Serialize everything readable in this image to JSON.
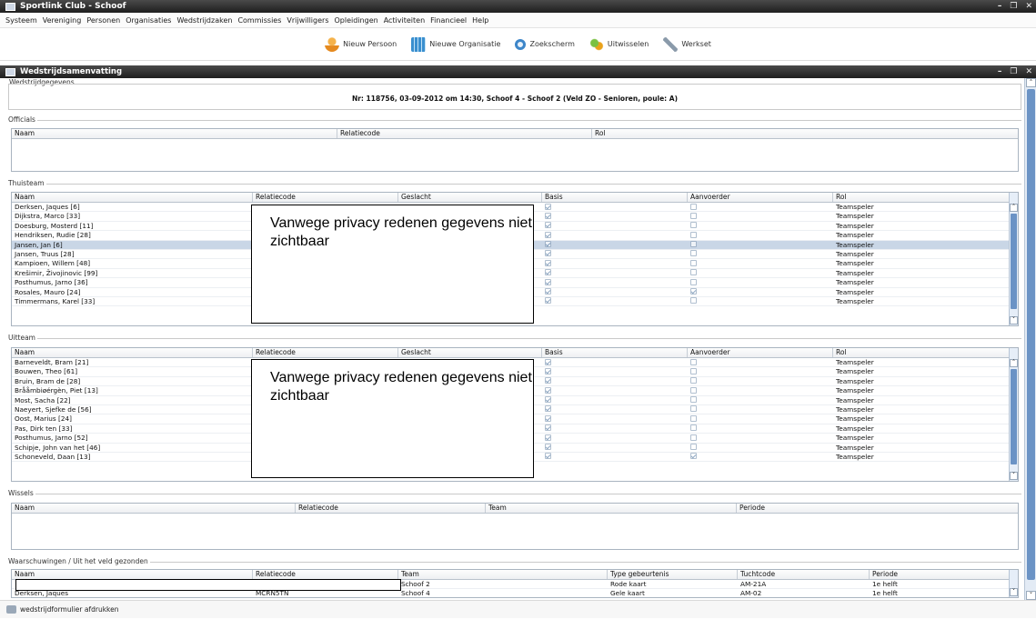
{
  "window": {
    "title": "Sportlink Club - Schoof",
    "controls": [
      "–",
      "❐",
      "✕"
    ]
  },
  "menu": [
    "Systeem",
    "Vereniging",
    "Personen",
    "Organisaties",
    "Wedstrijdzaken",
    "Commissies",
    "Vrijwilligers",
    "Opleidingen",
    "Activiteiten",
    "Financieel",
    "Help"
  ],
  "toolbar": [
    {
      "label": "Nieuw Persoon",
      "icon": "person-add-icon"
    },
    {
      "label": "Nieuwe Organisatie",
      "icon": "organisation-add-icon"
    },
    {
      "label": "Zoekscherm",
      "icon": "search-icon"
    },
    {
      "label": "Uitwisselen",
      "icon": "exchange-icon"
    },
    {
      "label": "Werkset",
      "icon": "tools-icon"
    }
  ],
  "subwindow": {
    "title": "Wedstrijdsamenvatting"
  },
  "wedstrijdgegevens": {
    "title": "Wedstrijdgegevens",
    "summary": "Nr: 118756, 03-09-2012 om 14:30, Schoof 4 - Schoof 2 (Veld ZO - Senioren, poule: A)"
  },
  "officials": {
    "title": "Officials",
    "columns": [
      "Naam",
      "Relatiecode",
      "Rol"
    ]
  },
  "thuisteam": {
    "title": "Thuisteam",
    "columns": [
      "Naam",
      "Relatiecode",
      "Geslacht",
      "Basis",
      "Aanvoerder",
      "Rol"
    ],
    "rows": [
      {
        "naam": "Derksen, Jaques [6]",
        "basis": true,
        "aanvoerder": false,
        "rol": "Teamspeler"
      },
      {
        "naam": "Dijkstra, Marco [33]",
        "basis": true,
        "aanvoerder": false,
        "rol": "Teamspeler"
      },
      {
        "naam": "Doesburg, Mosterd [11]",
        "basis": true,
        "aanvoerder": false,
        "rol": "Teamspeler"
      },
      {
        "naam": "Hendriksen, Rudie [28]",
        "basis": true,
        "aanvoerder": false,
        "rol": "Teamspeler"
      },
      {
        "naam": "Jansen, Jan [6]",
        "basis": true,
        "aanvoerder": false,
        "rol": "Teamspeler",
        "selected": true
      },
      {
        "naam": "Jansen, Truus [28]",
        "basis": true,
        "aanvoerder": false,
        "rol": "Teamspeler"
      },
      {
        "naam": "Kampioen, Willem [48]",
        "basis": true,
        "aanvoerder": false,
        "rol": "Teamspeler"
      },
      {
        "naam": "Krešimir, Živojinovic [99]",
        "basis": true,
        "aanvoerder": false,
        "rol": "Teamspeler"
      },
      {
        "naam": "Posthumus, Jarno [36]",
        "basis": true,
        "aanvoerder": false,
        "rol": "Teamspeler"
      },
      {
        "naam": "Rosales, Mauro [24]",
        "basis": true,
        "aanvoerder": true,
        "rol": "Teamspeler"
      },
      {
        "naam": "Timmermans, Karel [33]",
        "basis": true,
        "aanvoerder": false,
        "rol": "Teamspeler"
      }
    ],
    "privacy_note": "Vanwege privacy redenen gegevens niet zichtbaar"
  },
  "uitteam": {
    "title": "Uitteam",
    "columns": [
      "Naam",
      "Relatiecode",
      "Geslacht",
      "Basis",
      "Aanvoerder",
      "Rol"
    ],
    "rows": [
      {
        "naam": "Barneveldt, Bram [21]",
        "basis": true,
        "aanvoerder": false,
        "rol": "Teamspeler"
      },
      {
        "naam": "Bouwen, Theo [61]",
        "basis": true,
        "aanvoerder": false,
        "rol": "Teamspeler"
      },
      {
        "naam": "Bruin, Bram de [28]",
        "basis": true,
        "aanvoerder": false,
        "rol": "Teamspeler"
      },
      {
        "naam": "Brååmbiøérgèn, Piet [13]",
        "basis": true,
        "aanvoerder": false,
        "rol": "Teamspeler"
      },
      {
        "naam": "Most, Sacha [22]",
        "basis": true,
        "aanvoerder": false,
        "rol": "Teamspeler"
      },
      {
        "naam": "Naeyert, Sjefke de [56]",
        "basis": true,
        "aanvoerder": false,
        "rol": "Teamspeler"
      },
      {
        "naam": "Oost, Marius [24]",
        "basis": true,
        "aanvoerder": false,
        "rol": "Teamspeler"
      },
      {
        "naam": "Pas, Dirk ten [33]",
        "basis": true,
        "aanvoerder": false,
        "rol": "Teamspeler"
      },
      {
        "naam": "Posthumus, Jarno [52]",
        "basis": true,
        "aanvoerder": false,
        "rol": "Teamspeler"
      },
      {
        "naam": "Schipje, John van het [46]",
        "basis": true,
        "aanvoerder": false,
        "rol": "Teamspeler"
      },
      {
        "naam": "Schoneveld, Daan [13]",
        "basis": true,
        "aanvoerder": true,
        "rol": "Teamspeler"
      }
    ],
    "privacy_note": "Vanwege privacy redenen gegevens niet zichtbaar"
  },
  "wissels": {
    "title": "Wissels",
    "columns": [
      "Naam",
      "Relatiecode",
      "Team",
      "Periode"
    ]
  },
  "waarschuwingen": {
    "title": "Waarschuwingen / Uit het veld gezonden",
    "columns": [
      "Naam",
      "Relatiecode",
      "Team",
      "Type gebeurtenis",
      "Tuchtcode",
      "Periode"
    ],
    "rows": [
      {
        "naam": "",
        "relatiecode": "",
        "team": "Schoof 2",
        "type": "Rode kaart",
        "tuchtcode": "AM-21A",
        "periode": "1e helft"
      },
      {
        "naam": "Derksen, Jaques",
        "relatiecode": "MCRN5TN",
        "team": "Schoof 4",
        "type": "Gele kaart",
        "tuchtcode": "AM-02",
        "periode": "1e helft"
      }
    ]
  },
  "statusbar": {
    "print_label": "wedstrijdformulier afdrukken"
  }
}
